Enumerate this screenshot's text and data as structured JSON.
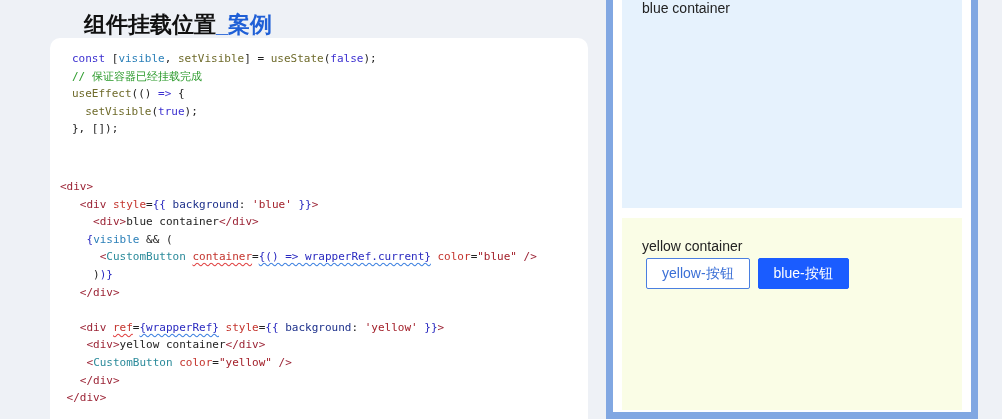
{
  "title": {
    "main": "组件挂载位置",
    "suffix": "_案例"
  },
  "code_blocks": [
    {
      "lines": [
        [
          {
            "kind": "keyword",
            "text": "const"
          },
          {
            "kind": "plain",
            "text": " ["
          },
          {
            "kind": "variable",
            "text": "visible"
          },
          {
            "kind": "plain",
            "text": ", "
          },
          {
            "kind": "function",
            "text": "setVisible"
          },
          {
            "kind": "plain",
            "text": "] = "
          },
          {
            "kind": "function",
            "text": "useState"
          },
          {
            "kind": "plain",
            "text": "("
          },
          {
            "kind": "keyword",
            "text": "false"
          },
          {
            "kind": "plain",
            "text": ");"
          }
        ],
        [
          {
            "kind": "comment",
            "text": "// 保证容器已经挂载完成"
          }
        ],
        [
          {
            "kind": "function",
            "text": "useEffect"
          },
          {
            "kind": "plain",
            "text": "(() "
          },
          {
            "kind": "keyword",
            "text": "=>"
          },
          {
            "kind": "plain",
            "text": " {"
          }
        ],
        [
          {
            "kind": "function",
            "text": "  setVisible"
          },
          {
            "kind": "plain",
            "text": "("
          },
          {
            "kind": "keyword",
            "text": "true"
          },
          {
            "kind": "plain",
            "text": ");"
          }
        ],
        [
          {
            "kind": "plain",
            "text": "}, []);"
          }
        ]
      ]
    },
    {
      "lines": [
        [
          {
            "kind": "tag",
            "text": "<div>"
          }
        ],
        [
          {
            "kind": "tag",
            "text": "   <div "
          },
          {
            "kind": "attr",
            "text": "style"
          },
          {
            "kind": "plain",
            "text": "="
          },
          {
            "kind": "expr",
            "text": "{{ "
          },
          {
            "kind": "key",
            "text": "background"
          },
          {
            "kind": "plain",
            "text": ": "
          },
          {
            "kind": "string",
            "text": "'blue'"
          },
          {
            "kind": "expr",
            "text": " }}"
          },
          {
            "kind": "tag",
            "text": ">"
          }
        ],
        [
          {
            "kind": "tag",
            "text": "     <div>"
          },
          {
            "kind": "plain",
            "text": "blue container"
          },
          {
            "kind": "tag",
            "text": "</div>"
          }
        ],
        [
          {
            "kind": "expr",
            "text": "    {"
          },
          {
            "kind": "variable",
            "text": "visible"
          },
          {
            "kind": "plain",
            "text": " && ("
          }
        ],
        [
          {
            "kind": "tag",
            "text": "      <"
          },
          {
            "kind": "component",
            "text": "CustomButton "
          },
          {
            "kind": "attr-error",
            "text": "container"
          },
          {
            "kind": "plain",
            "text": "="
          },
          {
            "kind": "expr-error",
            "text": "{() => wrapperRef.current}"
          },
          {
            "kind": "attr",
            "text": " color"
          },
          {
            "kind": "plain",
            "text": "="
          },
          {
            "kind": "string",
            "text": "\"blue\""
          },
          {
            "kind": "tag",
            "text": " />"
          }
        ],
        [
          {
            "kind": "plain",
            "text": "     )"
          },
          {
            "kind": "expr",
            "text": ")}"
          }
        ],
        [
          {
            "kind": "tag",
            "text": "   </div>"
          }
        ]
      ]
    },
    {
      "lines": [
        [
          {
            "kind": "tag",
            "text": "   <div "
          },
          {
            "kind": "attr-error",
            "text": "ref"
          },
          {
            "kind": "plain",
            "text": "="
          },
          {
            "kind": "expr-error",
            "text": "{wrapperRef}"
          },
          {
            "kind": "attr",
            "text": " style"
          },
          {
            "kind": "plain",
            "text": "="
          },
          {
            "kind": "expr",
            "text": "{{ "
          },
          {
            "kind": "key",
            "text": "background"
          },
          {
            "kind": "plain",
            "text": ": "
          },
          {
            "kind": "string",
            "text": "'yellow'"
          },
          {
            "kind": "expr",
            "text": " }}"
          },
          {
            "kind": "tag",
            "text": ">"
          }
        ],
        [
          {
            "kind": "tag",
            "text": "    <div>"
          },
          {
            "kind": "plain",
            "text": "yellow container"
          },
          {
            "kind": "tag",
            "text": "</div>"
          }
        ],
        [
          {
            "kind": "tag",
            "text": "    <"
          },
          {
            "kind": "component",
            "text": "CustomButton "
          },
          {
            "kind": "attr",
            "text": "color"
          },
          {
            "kind": "plain",
            "text": "="
          },
          {
            "kind": "string",
            "text": "\"yellow\""
          },
          {
            "kind": "tag",
            "text": " />"
          }
        ],
        [
          {
            "kind": "tag",
            "text": "   </div>"
          }
        ],
        [
          {
            "kind": "tag",
            "text": " </div>"
          }
        ]
      ]
    }
  ],
  "preview": {
    "blue_container": {
      "label": "blue container"
    },
    "yellow_container": {
      "label": "yellow container",
      "buttons": [
        {
          "label": "yellow-按钮",
          "kind": "outline"
        },
        {
          "label": "blue-按钮",
          "kind": "primary"
        }
      ]
    }
  }
}
